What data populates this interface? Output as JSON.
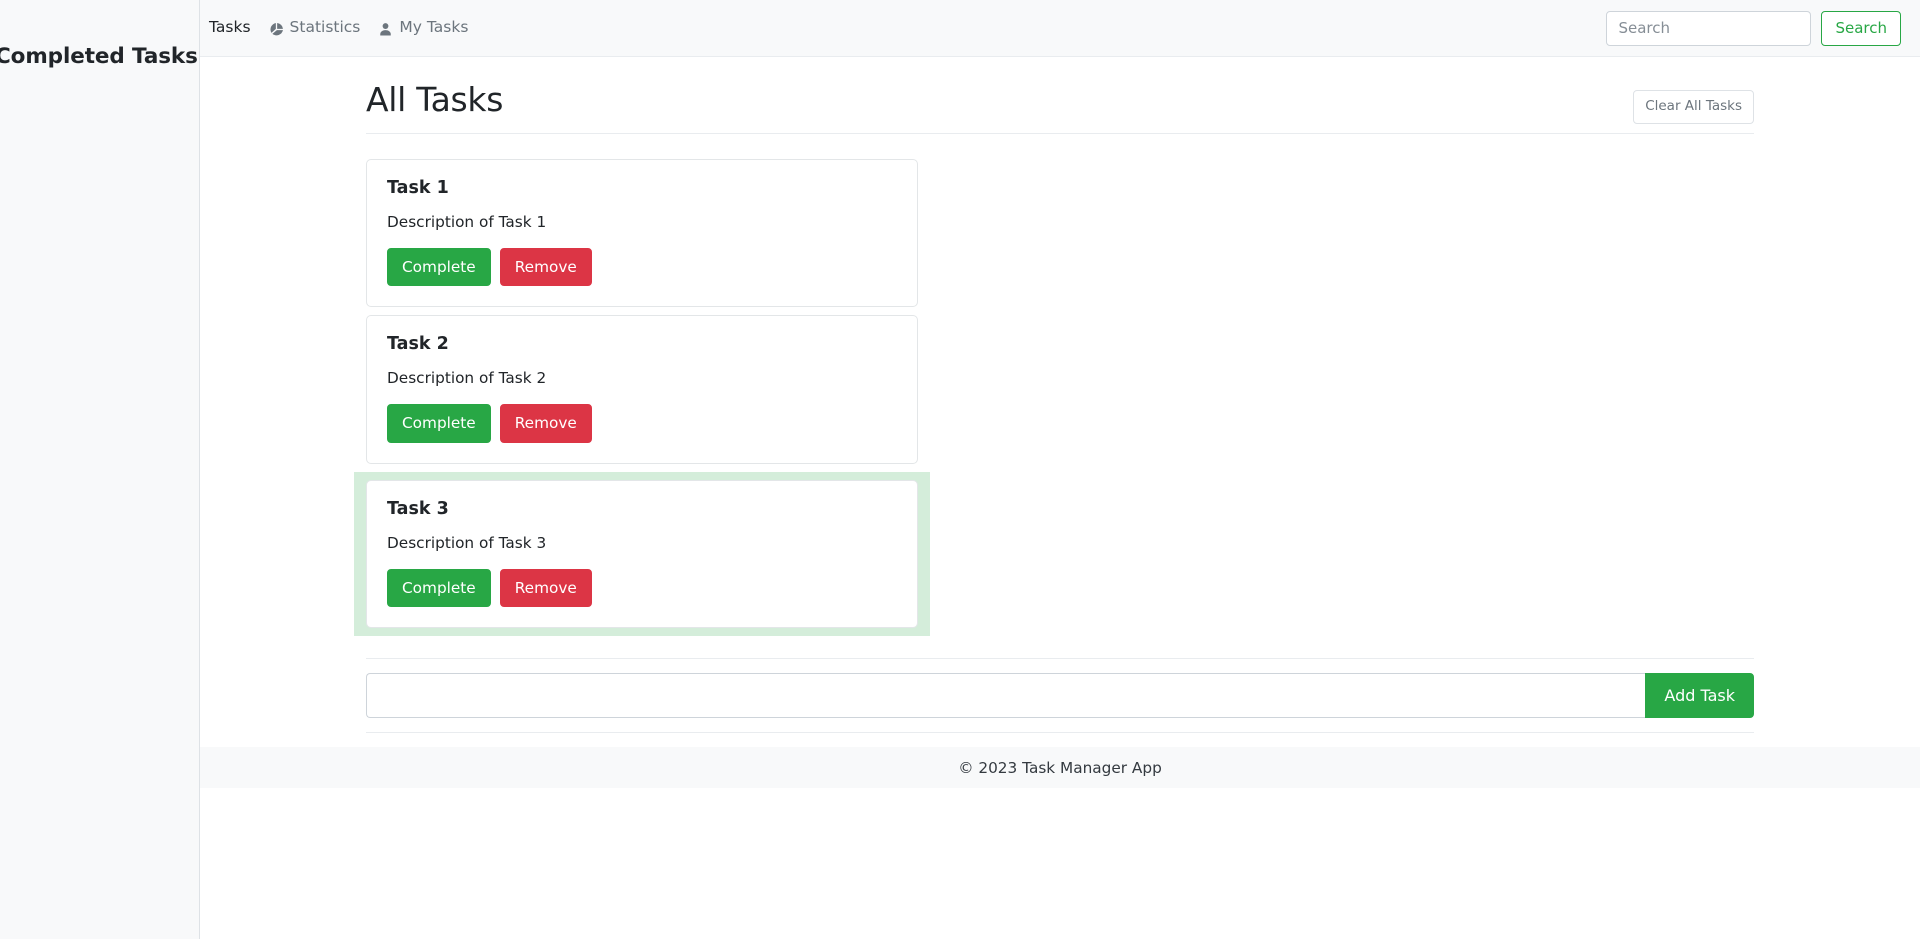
{
  "sidebar": {
    "title": "Completed Tasks"
  },
  "navbar": {
    "links": [
      {
        "label": "Tasks",
        "icon": "",
        "active": true
      },
      {
        "label": "Statistics",
        "icon": "pie-chart-icon",
        "active": false
      },
      {
        "label": "My Tasks",
        "icon": "person-icon",
        "active": false
      }
    ],
    "search": {
      "placeholder": "Search",
      "value": "",
      "button_label": "Search"
    }
  },
  "page": {
    "title": "All Tasks",
    "clear_all_label": "Clear All Tasks"
  },
  "tasks": [
    {
      "title": "Task 1",
      "description": "Description of Task 1",
      "complete_label": "Complete",
      "remove_label": "Remove",
      "completed": false
    },
    {
      "title": "Task 2",
      "description": "Description of Task 2",
      "complete_label": "Complete",
      "remove_label": "Remove",
      "completed": false
    },
    {
      "title": "Task 3",
      "description": "Description of Task 3",
      "complete_label": "Complete",
      "remove_label": "Remove",
      "completed": true
    }
  ],
  "add_form": {
    "placeholder": "",
    "value": "",
    "button_label": "Add Task"
  },
  "footer": {
    "text": "© 2023 Task Manager App"
  },
  "colors": {
    "success": "#28a745",
    "danger": "#dc3545",
    "completed_highlight": "#d4edda",
    "muted": "#6c757d",
    "surface": "#f8f9fa"
  }
}
